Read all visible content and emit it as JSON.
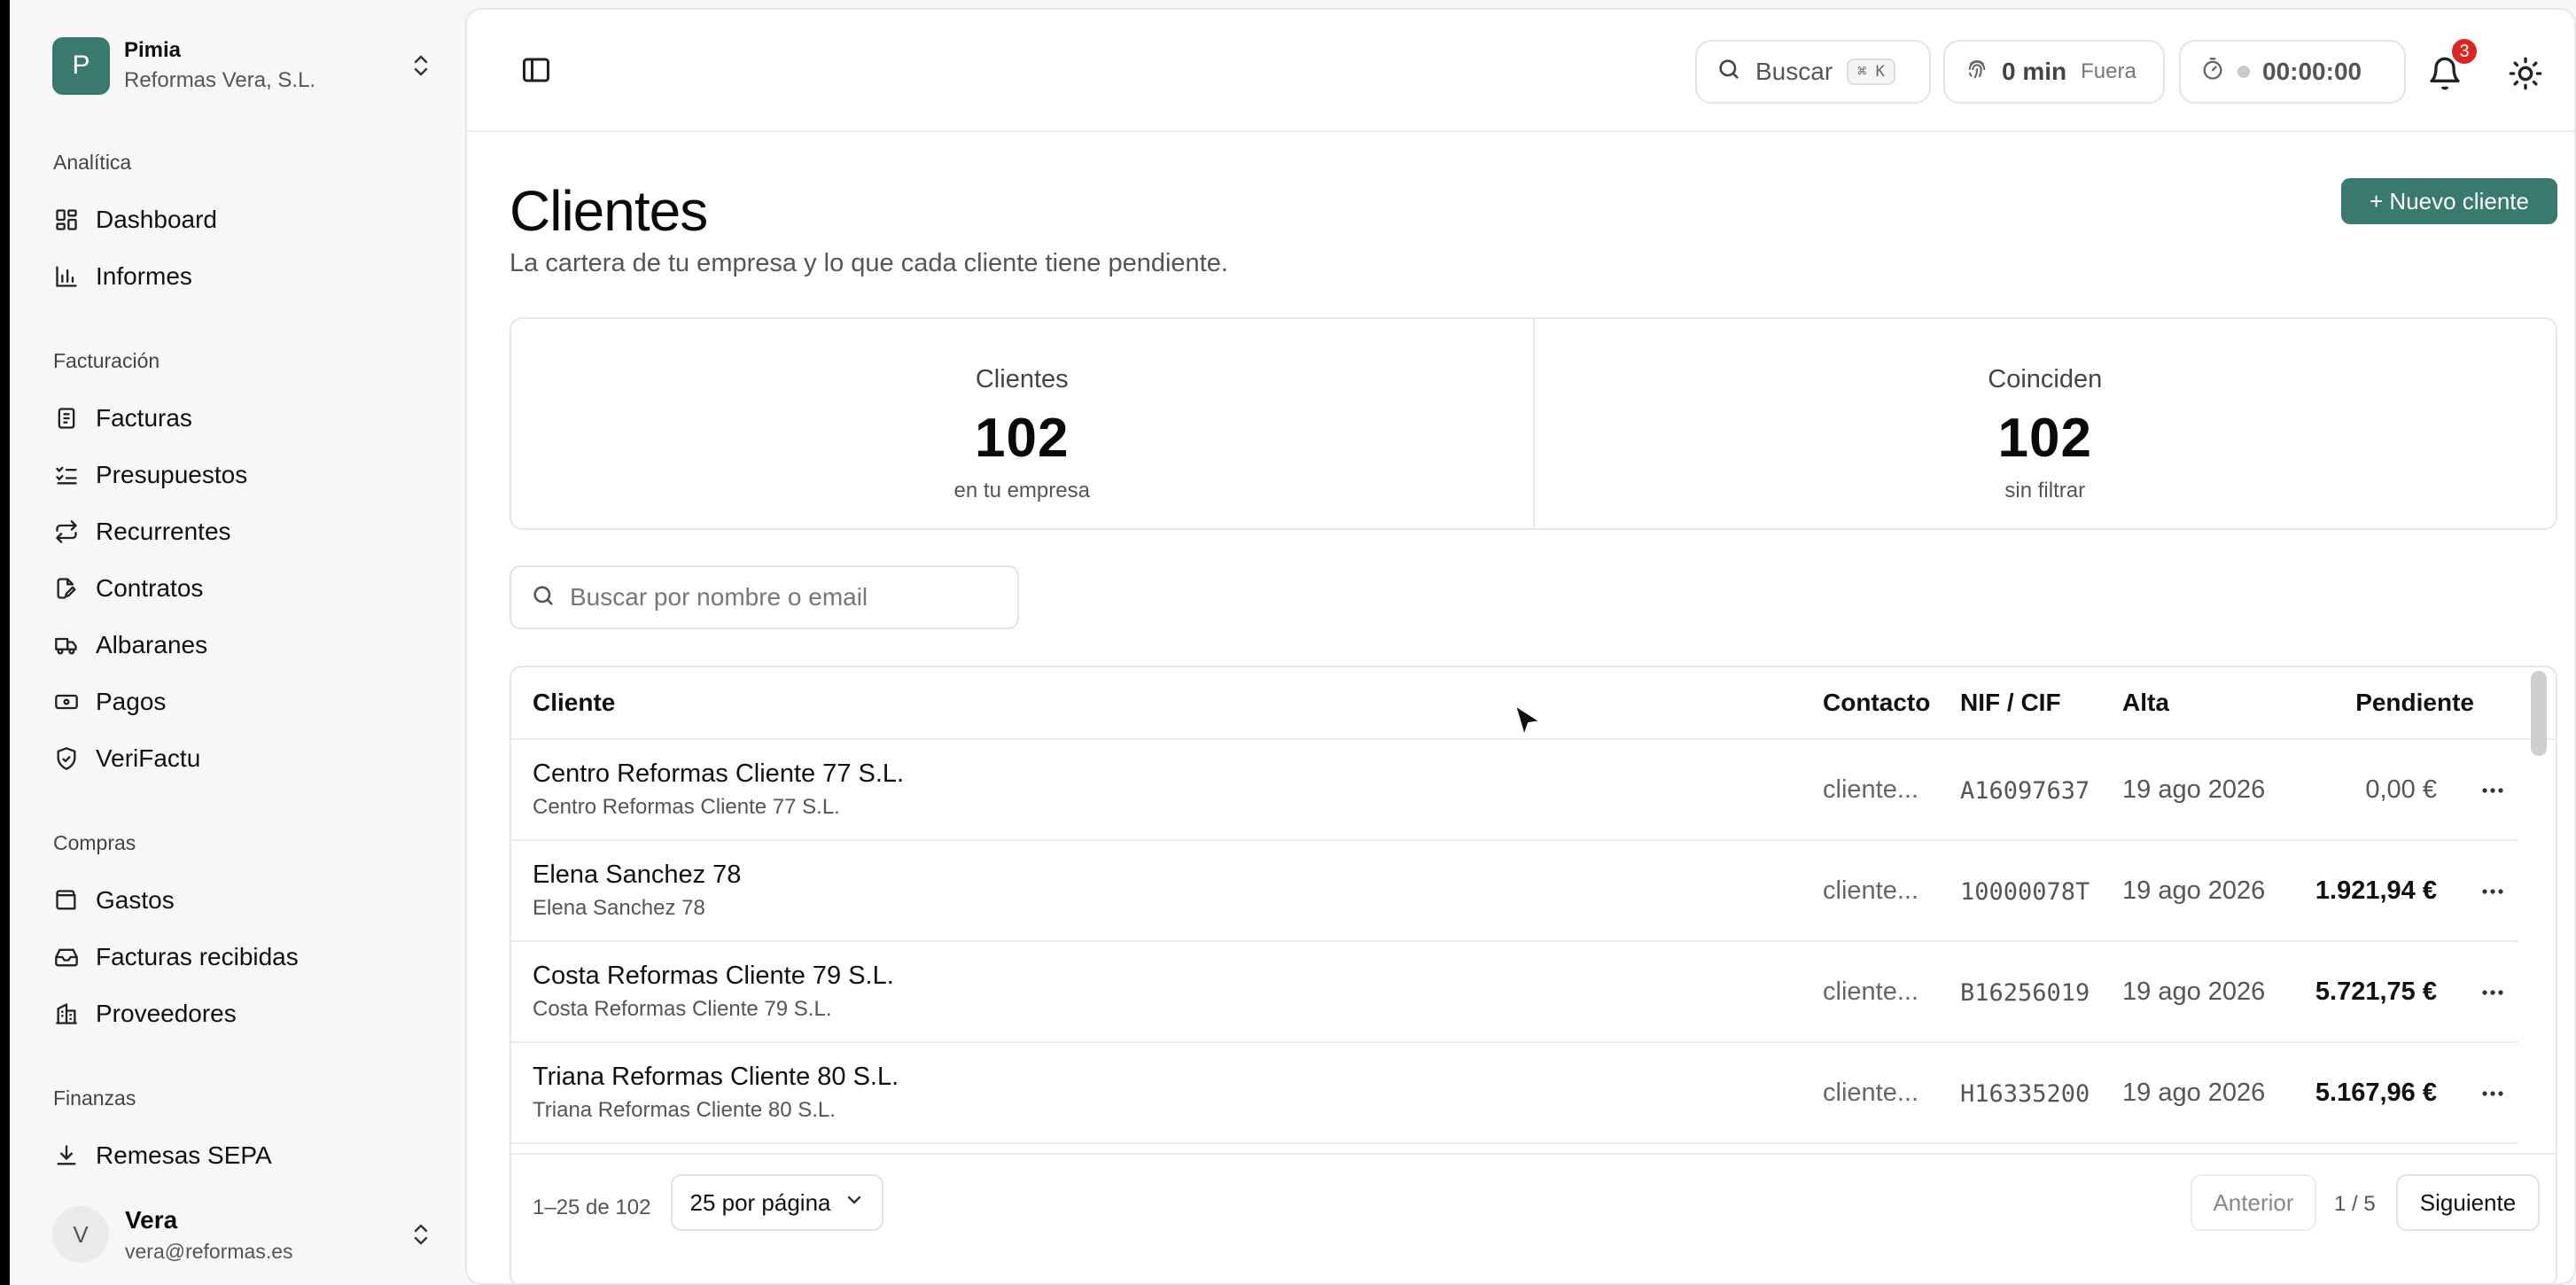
{
  "org": {
    "initial": "P",
    "name": "Pimia",
    "company": "Reformas Vera, S.L."
  },
  "sidebar": {
    "sections": [
      {
        "title": "Analítica",
        "items": [
          {
            "label": "Dashboard",
            "icon": "dashboard-icon"
          },
          {
            "label": "Informes",
            "icon": "bar-chart-icon"
          }
        ]
      },
      {
        "title": "Facturación",
        "items": [
          {
            "label": "Facturas",
            "icon": "receipt-icon"
          },
          {
            "label": "Presupuestos",
            "icon": "list-checks-icon"
          },
          {
            "label": "Recurrentes",
            "icon": "repeat-icon"
          },
          {
            "label": "Contratos",
            "icon": "file-pen-icon"
          },
          {
            "label": "Albaranes",
            "icon": "truck-icon"
          },
          {
            "label": "Pagos",
            "icon": "banknote-icon"
          },
          {
            "label": "VeriFactu",
            "icon": "shield-check-icon"
          }
        ]
      },
      {
        "title": "Compras",
        "items": [
          {
            "label": "Gastos",
            "icon": "wallet-icon"
          },
          {
            "label": "Facturas recibidas",
            "icon": "inbox-icon"
          },
          {
            "label": "Proveedores",
            "icon": "building-icon"
          }
        ]
      },
      {
        "title": "Finanzas",
        "items": [
          {
            "label": "Remesas SEPA",
            "icon": "download-icon"
          }
        ]
      }
    ]
  },
  "user": {
    "initial": "V",
    "name": "Vera",
    "email": "vera@reformas.es"
  },
  "topbar": {
    "search_label": "Buscar",
    "search_shortcut": "⌘ K",
    "presence_time": "0 min",
    "presence_status": "Fuera",
    "timer": "00:00:00",
    "notifications_count": "3"
  },
  "page": {
    "title": "Clientes",
    "subtitle": "La cartera de tu empresa y lo que cada cliente tiene pendiente.",
    "new_button": "+ Nuevo cliente"
  },
  "stats": [
    {
      "label": "Clientes",
      "value": "102",
      "note": "en tu empresa"
    },
    {
      "label": "Coinciden",
      "value": "102",
      "note": "sin filtrar"
    }
  ],
  "search": {
    "placeholder": "Buscar por nombre o email"
  },
  "table": {
    "headers": {
      "client": "Cliente",
      "contact": "Contacto",
      "nif": "NIF / CIF",
      "alta": "Alta",
      "pending": "Pendiente"
    },
    "rows": [
      {
        "name": "Centro Reformas Cliente 77 S.L.",
        "legal": "Centro Reformas Cliente 77 S.L.",
        "contact": "cliente...",
        "nif": "A16097637",
        "alta": "19 ago 2026",
        "pending": "0,00 €"
      },
      {
        "name": "Elena Sanchez 78",
        "legal": "Elena Sanchez 78",
        "contact": "cliente...",
        "nif": "10000078T",
        "alta": "19 ago 2026",
        "pending": "1.921,94 €"
      },
      {
        "name": "Costa Reformas Cliente 79 S.L.",
        "legal": "Costa Reformas Cliente 79 S.L.",
        "contact": "cliente...",
        "nif": "B16256019",
        "alta": "19 ago 2026",
        "pending": "5.721,75 €"
      },
      {
        "name": "Triana Reformas Cliente 80 S.L.",
        "legal": "Triana Reformas Cliente 80 S.L.",
        "contact": "cliente...",
        "nif": "H16335200",
        "alta": "19 ago 2026",
        "pending": "5.167,96 €"
      }
    ],
    "footer": {
      "range": "1–25 de 102",
      "per_page": "25 por página",
      "prev": "Anterior",
      "page": "1 / 5",
      "next": "Siguiente"
    }
  },
  "colors": {
    "accent": "#3a7a6e",
    "badge": "#dc2626"
  }
}
